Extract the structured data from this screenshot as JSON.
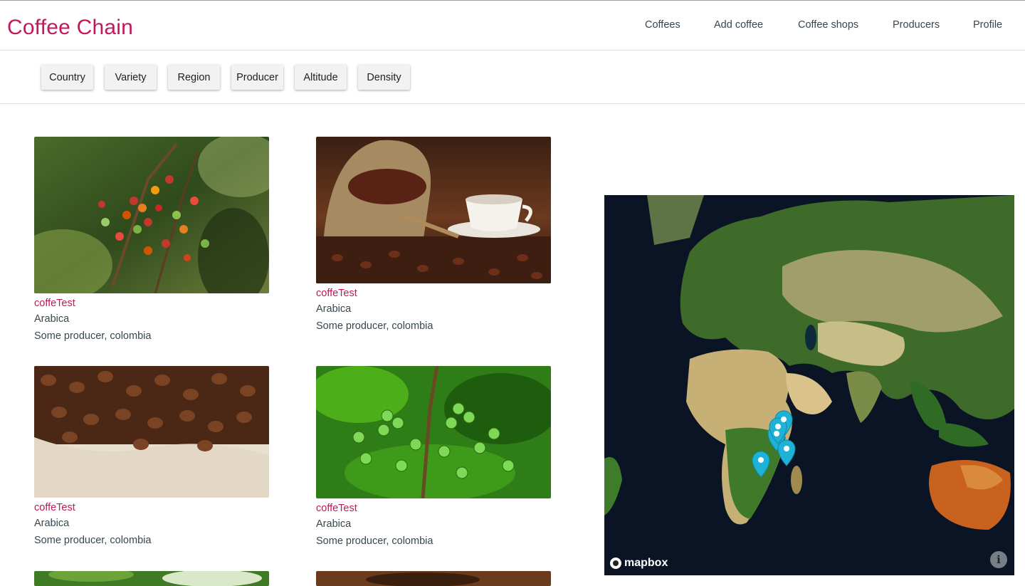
{
  "app": {
    "brand": "Coffee Chain"
  },
  "nav": {
    "items": [
      "Coffees",
      "Add coffee",
      "Coffee shops",
      "Producers",
      "Profile"
    ]
  },
  "filters": {
    "buttons": [
      "Country",
      "Variety",
      "Region",
      "Producer",
      "Altitude",
      "Density"
    ]
  },
  "coffees": [
    {
      "name": "coffeTest",
      "variety": "Arabica",
      "producer": "Some producer, colombia",
      "image": "coffee-cherries-branch"
    },
    {
      "name": "coffeTest",
      "variety": "Arabica",
      "producer": "Some producer, colombia",
      "image": "beans-sack-cup"
    },
    {
      "name": "coffeTest",
      "variety": "Arabica",
      "producer": "Some producer, colombia",
      "image": "roasted-beans-burlap"
    },
    {
      "name": "coffeTest",
      "variety": "Arabica",
      "producer": "Some producer, colombia",
      "image": "green-coffee-cherries"
    },
    {
      "name": "",
      "variety": "",
      "producer": "",
      "image": "coffee-plant-partial"
    },
    {
      "name": "",
      "variety": "",
      "producer": "",
      "image": "beans-partial"
    }
  ],
  "map": {
    "attribution": "mapbox",
    "info_icon": "info-icon",
    "marker_color": "#1eb3d6",
    "marker_count": 5
  },
  "colors": {
    "brand": "#c2185b",
    "nav_text": "#37474f",
    "accent": "#c2185b"
  }
}
